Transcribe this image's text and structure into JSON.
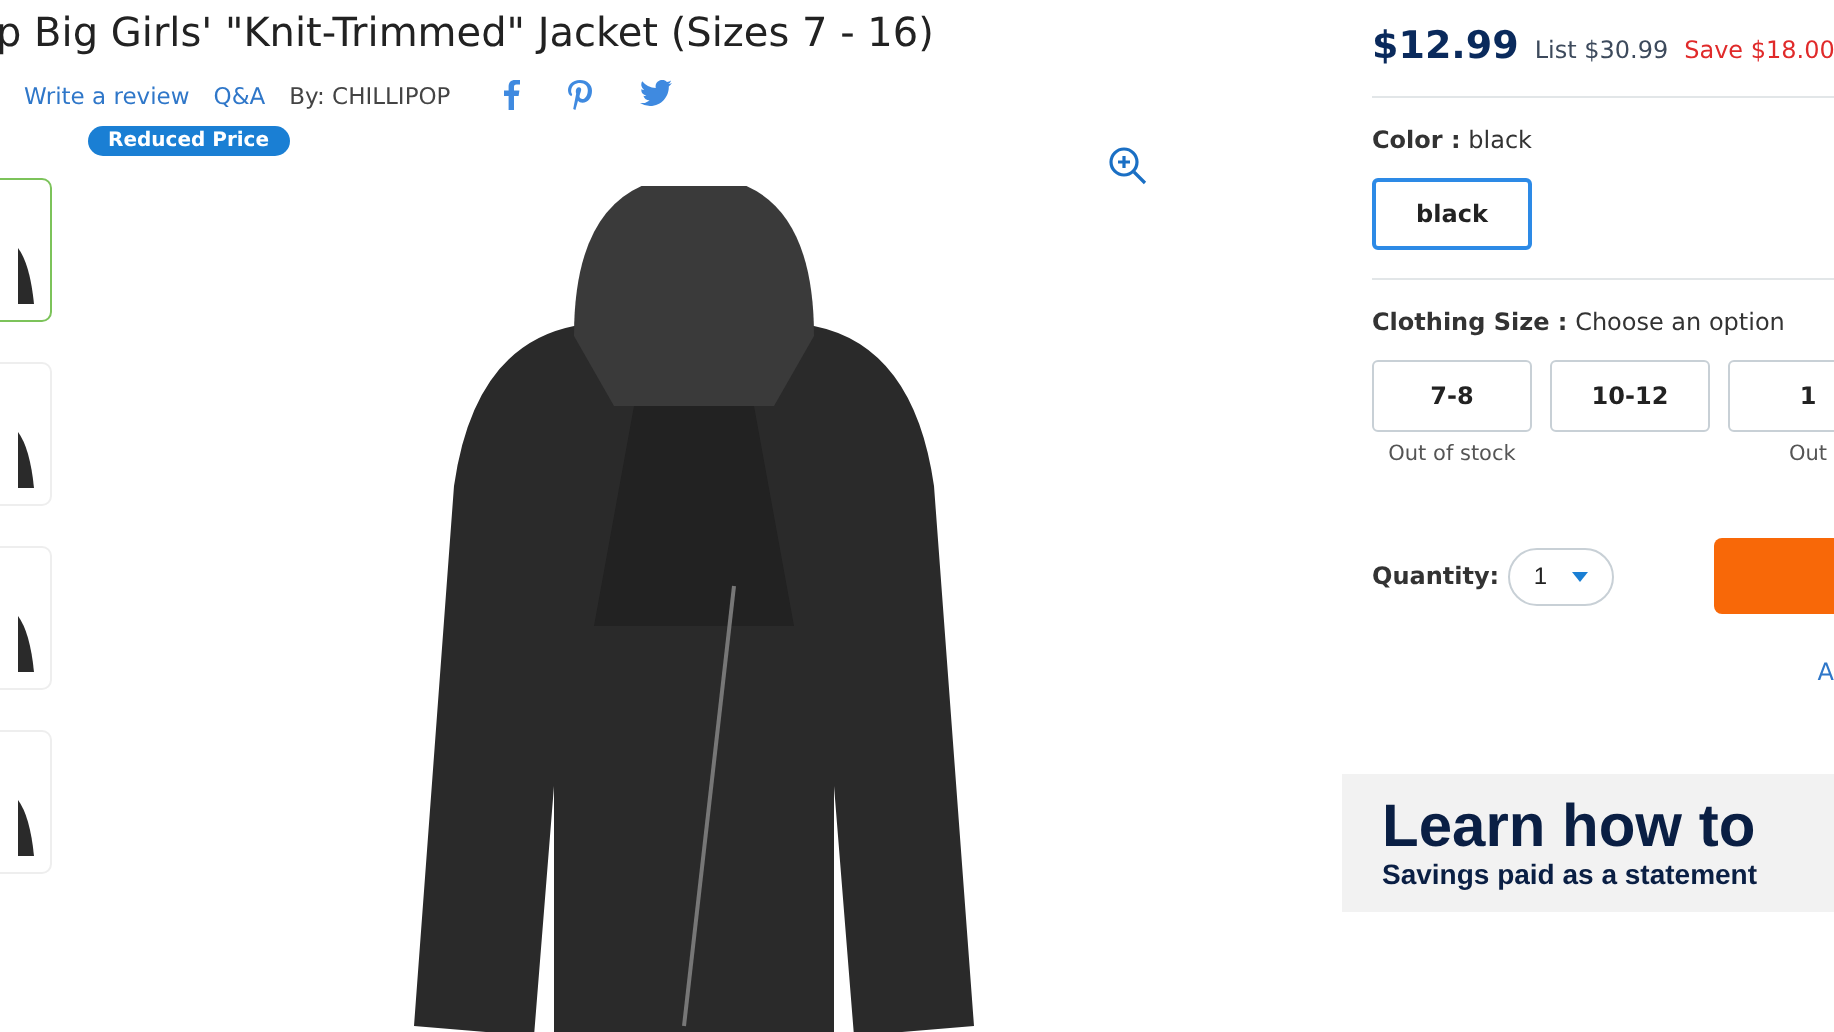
{
  "title": "p Big Girls' \"Knit-Trimmed\" Jacket (Sizes 7 - 16)",
  "links": {
    "review": "Write a review",
    "qa": "Q&A",
    "by": "By: CHILLIPOP"
  },
  "badge": "Reduced Price",
  "thumbnails": [
    {
      "selected": true
    },
    {
      "selected": false
    },
    {
      "selected": false
    },
    {
      "selected": false
    }
  ],
  "price": {
    "current": "$12.99",
    "list": "List $30.99",
    "save": "Save $18.00"
  },
  "color": {
    "label": "Color :",
    "value": "black",
    "options": [
      {
        "label": "black",
        "selected": true
      }
    ]
  },
  "size": {
    "label": "Clothing Size :",
    "value": "Choose an option",
    "options": [
      {
        "label": "7-8",
        "note": "Out of stock"
      },
      {
        "label": "10-12"
      },
      {
        "label": "1",
        "note": "Out"
      }
    ]
  },
  "quantity": {
    "label": "Quantity:",
    "value": "1"
  },
  "link_cut": "A",
  "banner": {
    "headline": "Learn how to",
    "subline": "Savings paid as a statement"
  }
}
